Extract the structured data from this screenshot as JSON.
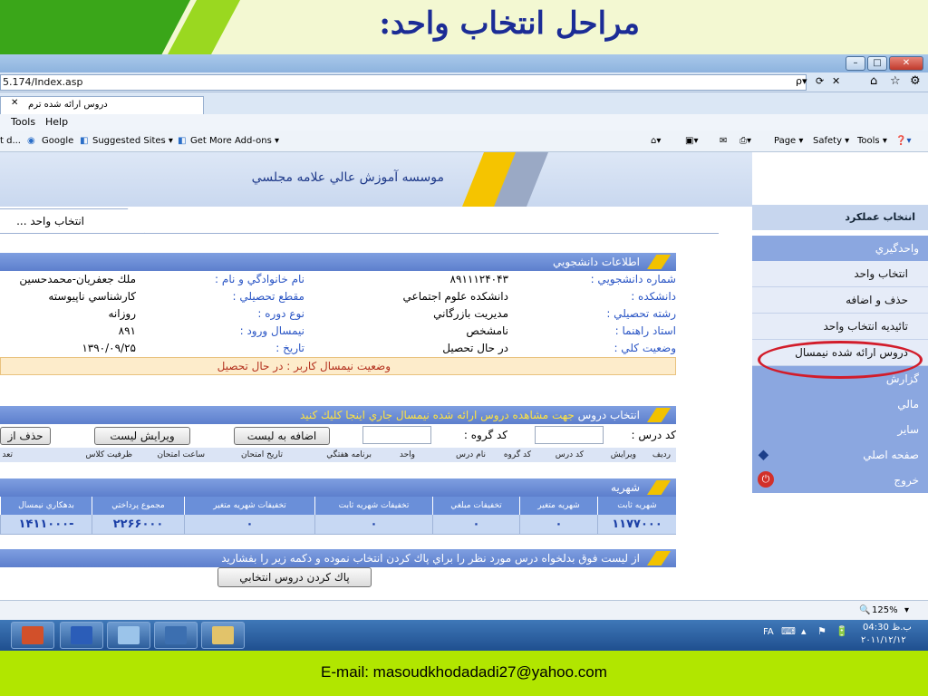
{
  "slide": {
    "title": "مراحل انتخاب واحد:",
    "footer_email": "E-mail: masoudkhodadadi27@yahoo.com"
  },
  "browser": {
    "url": "5.174/Index.asp",
    "tab_label": "دروس ارائه شده ترم",
    "menu": [
      "Tools",
      "Help"
    ],
    "favorites": [
      "Google",
      "Suggested Sites ▾",
      "Get More Add-ons ▾"
    ],
    "fav_prefix": "t d...",
    "commands": [
      "Page ▾",
      "Safety ▾",
      "Tools ▾"
    ],
    "zoom": "125%",
    "win_buttons": [
      "–",
      "□",
      "✕"
    ]
  },
  "page": {
    "banner_title": "موسسه آموزش عالي علامه مجلسي",
    "tab_title": "انتخاب واحد ...",
    "sidebar": {
      "header": "انتخاب عملكرد",
      "sections": [
        {
          "label": "واحدگيري",
          "items": [
            "انتخاب واحد",
            "حذف و اضافه",
            "تائيديه انتخاب واحد",
            "دروس ارائه شده نيمسال"
          ]
        },
        {
          "label": "گزارش",
          "items": []
        },
        {
          "label": "مالي",
          "items": []
        },
        {
          "label": "ساير",
          "items": []
        }
      ],
      "home": "صفحه اصلي",
      "exit": "خروج"
    },
    "student": {
      "header": "اطلاعات دانشجويي",
      "rows": [
        {
          "l1": "شماره دانشجويي :",
          "v1": "۸۹۱۱۱۲۴۰۴۳",
          "l2": "نام خانوادگي و نام :",
          "v2": "ملك جعفريان-محمدحسين"
        },
        {
          "l1": "دانشكده :",
          "v1": "دانشكده علوم اجتماعي",
          "l2": "مقطع تحصيلي :",
          "v2": "كارشناسي ناپيوسته"
        },
        {
          "l1": "رشته تحصيلي :",
          "v1": "مديريت بازرگاني",
          "l2": "نوع دوره :",
          "v2": "روزانه"
        },
        {
          "l1": "استاد راهنما :",
          "v1": "نامشخص",
          "l2": "نيمسال ورود :",
          "v2": "۸۹۱"
        },
        {
          "l1": "وضعيت كلي :",
          "v1": "در حال تحصيل",
          "l2": "تاريخ :",
          "v2": "۱۳۹۰/۰۹/۲۵"
        }
      ],
      "status": "وضعيت نيمسال كاربر : در حال تحصيل"
    },
    "courses": {
      "header_prefix": "انتخاب دروس",
      "header_link": "جهت مشاهده دروس ارائه شده نيمسال جاري اينجا كليك كنيد",
      "course_code_label": "كد درس :",
      "group_code_label": "كد گروه :",
      "add_button": "اضافه به ليست",
      "edit_button": "ويرايش ليست",
      "delete_button": "حذف از",
      "columns": [
        "رديف",
        "ويرايش",
        "كد درس",
        "كد گروه",
        "نام درس",
        "واحد",
        "برنامه هفتگي",
        "تاريخ امتحان",
        "ساعت امتحان",
        "ظرفيت كلاس",
        "تعد"
      ]
    },
    "tuition": {
      "header": "شهريه",
      "columns": [
        "شهريه ثابت",
        "شهريه متغير",
        "تخفيفات مبلغي",
        "تخفيفات شهريه ثابت",
        "تخفيفات شهريه متغير",
        "مجموع پرداختي",
        "بدهكاري نيمسال"
      ],
      "values": [
        "۱۱۷۷۰۰۰",
        "۰",
        "۰",
        "۰",
        "۰",
        "۲۲۶۶۰۰۰",
        "۱۴۱۱۰۰۰-"
      ]
    },
    "clear": {
      "header": "از ليست فوق بدلخواه درس مورد نظر را براي پاك كردن انتخاب نموده و دكمه زير را بفشاريد",
      "button": "پاك كردن دروس انتخابي"
    }
  },
  "taskbar": {
    "lang": "FA",
    "time": "04:30 ب.ظ",
    "date": "۲۰۱۱/۱۲/۱۲"
  },
  "colors": {
    "accent_blue": "#5d7fcd",
    "highlight_red": "#d21c2a",
    "footer_green": "#b1e600"
  }
}
